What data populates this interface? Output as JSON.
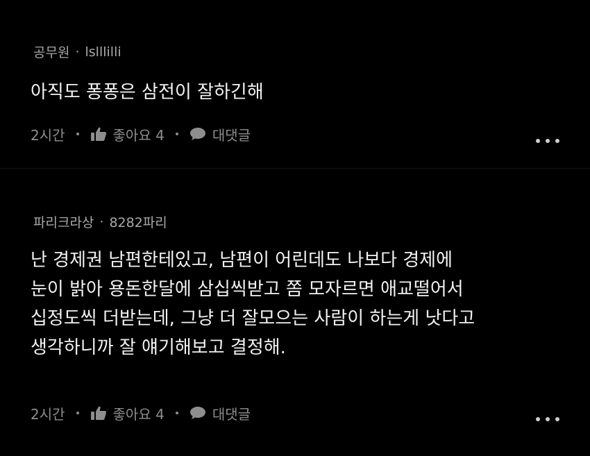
{
  "comments": [
    {
      "author": "공무원",
      "nickname": "lslllilli",
      "body_lines": [
        "아직도 퐁퐁은 삼전이 잘하긴해"
      ],
      "time": "2시간",
      "like_label": "좋아요 4",
      "reply_label": "대댓글"
    },
    {
      "author": "파리크라상",
      "nickname": "8282파리",
      "body_lines": [
        "난 경제권 남편한테있고, 남편이 어린데도 나보다 경제에",
        "눈이 밝아 용돈한달에 삼십씩받고 쫌 모자르면 애교떨어서",
        "십정도씩 더받는데, 그냥 더 잘모으는 사람이 하는게 낫다고",
        "생각하니까 잘 얘기해보고 결정해."
      ],
      "time": "2시간",
      "like_label": "좋아요 4",
      "reply_label": "대댓글"
    }
  ],
  "meta_separator": "·",
  "icons": {
    "like": "thumbs-up-icon",
    "reply": "speech-bubble-icon",
    "more": "more-horizontal-icon"
  },
  "colors": {
    "background": "#000000",
    "text": "#f2f2f2",
    "meta": "#a9a9a9",
    "footer": "#8e8e8e"
  }
}
